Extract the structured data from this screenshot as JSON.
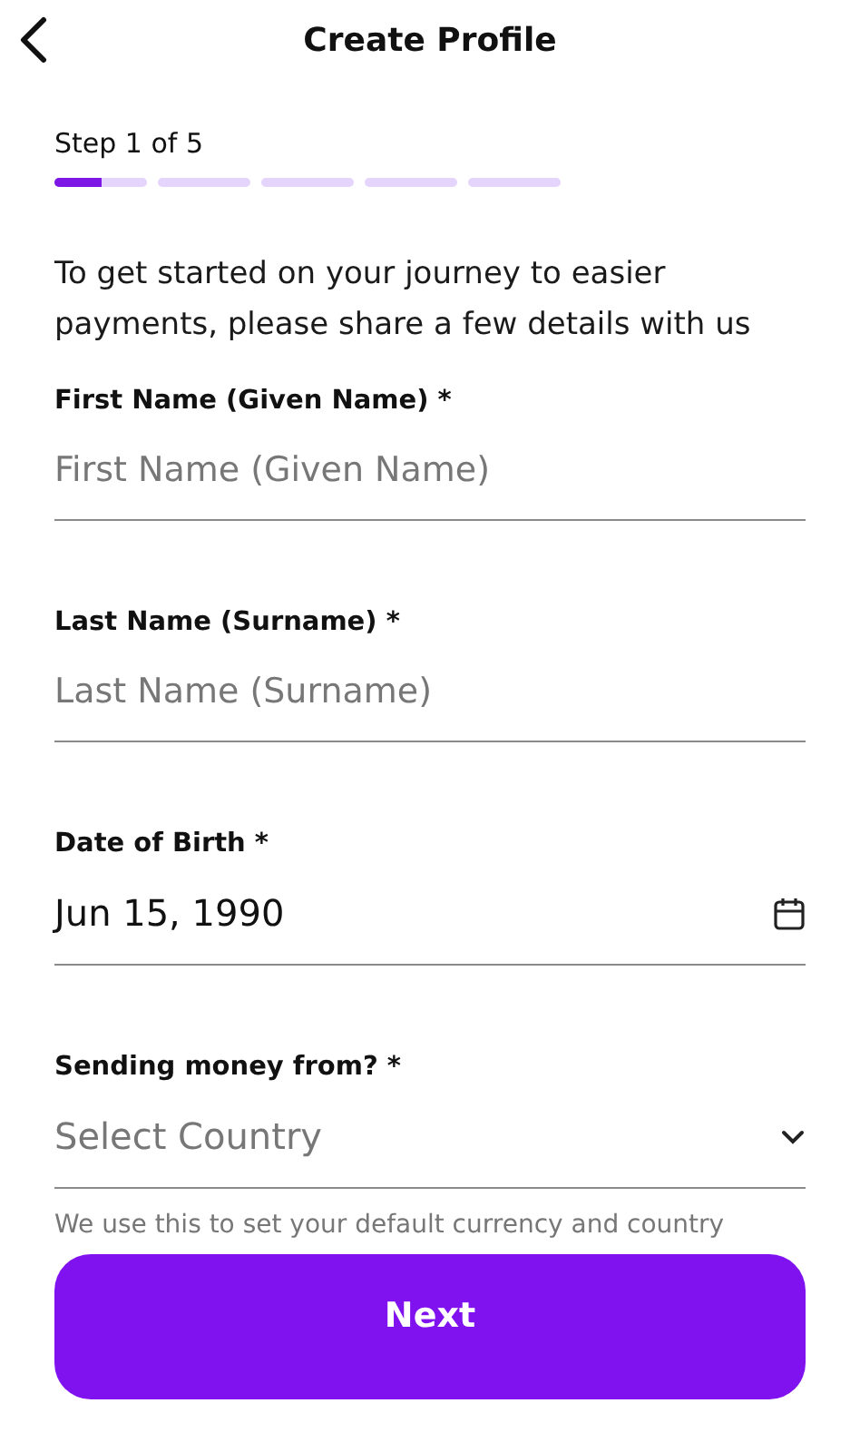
{
  "header": {
    "title": "Create Profile"
  },
  "progress": {
    "label": "Step 1 of 5",
    "segments": [
      {
        "current": true
      },
      {
        "current": false
      },
      {
        "current": false
      },
      {
        "current": false
      },
      {
        "current": false
      }
    ],
    "level": 0.5
  },
  "intro": "To get started on your journey to easier payments, please share a few details with us",
  "fields": [
    {
      "kind": "text",
      "label": "First Name (Given Name) *",
      "placeholder": "First Name (Given Name)"
    },
    {
      "kind": "text",
      "label": "Last Name (Surname) *",
      "placeholder": "Last Name (Surname)"
    },
    {
      "kind": "date",
      "label": "Date of Birth *",
      "value": "Jun 15, 1990"
    },
    {
      "kind": "select",
      "label": "Sending money from? *",
      "placeholder": "Select Country",
      "help": "We use this to set your default currency and country"
    }
  ],
  "next_button": "Next"
}
